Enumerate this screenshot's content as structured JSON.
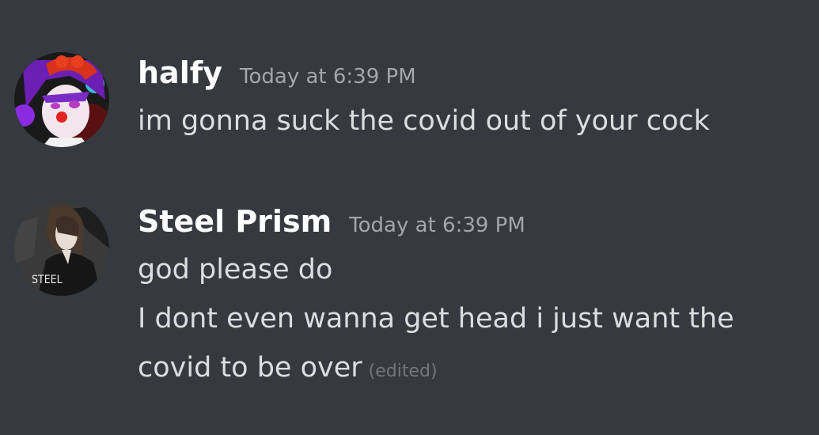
{
  "messages": [
    {
      "author": "halfy",
      "timestamp": "Today at 6:39 PM",
      "lines": [
        "im gonna suck the covid out of your cock"
      ],
      "avatar": "clown-character-avatar-icon"
    },
    {
      "author": "Steel Prism",
      "timestamp": "Today at 6:39 PM",
      "lines": [
        "god please do",
        "I dont even wanna get head i just want the",
        "covid to be over"
      ],
      "edited": "(edited)",
      "avatar": "dark-haired-character-avatar-icon",
      "avatar_text": "STEEL"
    }
  ],
  "colors": {
    "background": "#36393f",
    "username": "#ffffff",
    "timestamp": "#a3a6aa",
    "message_text": "#dcddde",
    "edited": "#72767d"
  }
}
